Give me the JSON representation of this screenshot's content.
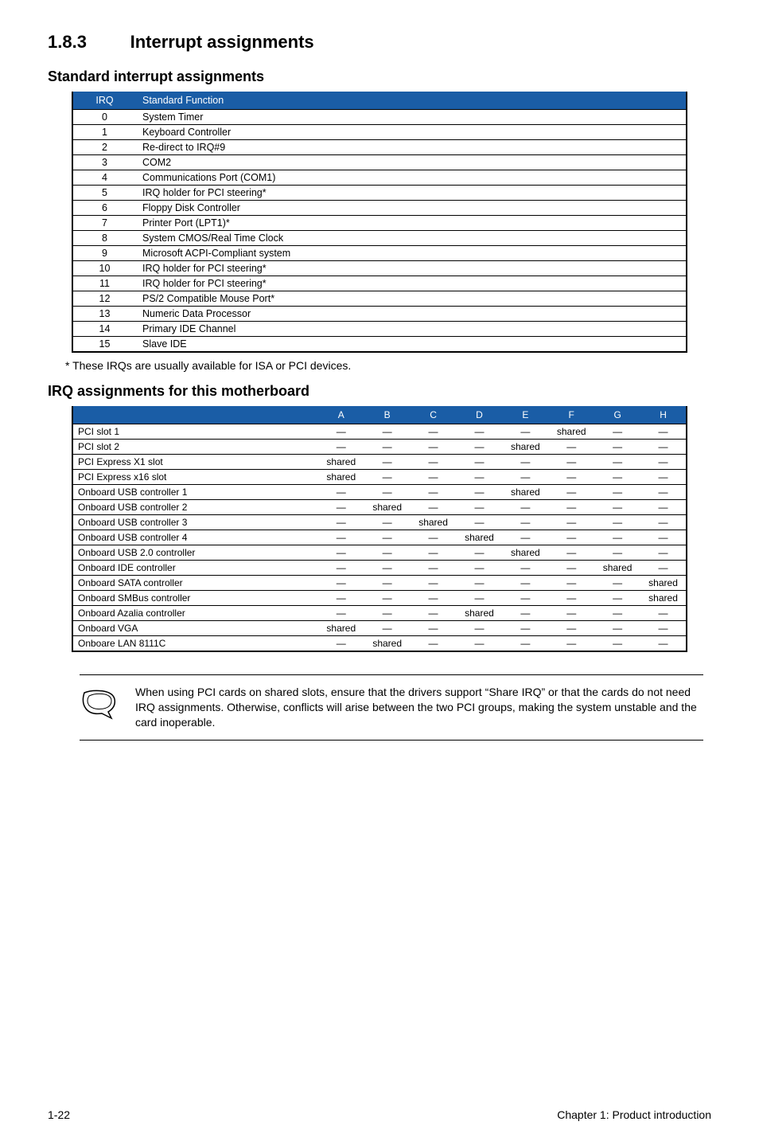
{
  "section": {
    "number": "1.8.3",
    "title": "Interrupt assignments"
  },
  "sub1": "Standard interrupt assignments",
  "table1": {
    "headers": [
      "IRQ",
      "Standard Function"
    ],
    "rows": [
      [
        "0",
        "System Timer"
      ],
      [
        "1",
        "Keyboard Controller"
      ],
      [
        "2",
        "Re-direct to IRQ#9"
      ],
      [
        "3",
        "COM2"
      ],
      [
        "4",
        "Communications Port (COM1)"
      ],
      [
        "5",
        "IRQ holder for PCI steering*"
      ],
      [
        "6",
        "Floppy Disk Controller"
      ],
      [
        "7",
        "Printer Port (LPT1)*"
      ],
      [
        "8",
        "System CMOS/Real Time Clock"
      ],
      [
        "9",
        "Microsoft ACPI-Compliant system"
      ],
      [
        "10",
        "IRQ holder for PCI steering*"
      ],
      [
        "11",
        "IRQ holder for PCI steering*"
      ],
      [
        "12",
        "PS/2 Compatible Mouse Port*"
      ],
      [
        "13",
        "Numeric Data Processor"
      ],
      [
        "14",
        "Primary IDE Channel"
      ],
      [
        "15",
        "Slave IDE"
      ]
    ]
  },
  "footnote": "* These IRQs are usually available for ISA or PCI devices.",
  "sub2": "IRQ assignments for this motherboard",
  "table2": {
    "headers": [
      "",
      "A",
      "B",
      "C",
      "D",
      "E",
      "F",
      "G",
      "H"
    ],
    "rows": [
      {
        "label": "PCI slot 1",
        "cells": [
          "—",
          "—",
          "—",
          "—",
          "—",
          "shared",
          "—",
          "—"
        ]
      },
      {
        "label": "PCI slot 2",
        "cells": [
          "—",
          "—",
          "—",
          "—",
          "shared",
          "—",
          "—",
          "—"
        ]
      },
      {
        "label": "PCI Express X1 slot",
        "cells": [
          "shared",
          "—",
          "—",
          "—",
          "—",
          "—",
          "—",
          "—"
        ]
      },
      {
        "label": "PCI Express x16 slot",
        "cells": [
          "shared",
          "—",
          "—",
          "—",
          "—",
          "—",
          "—",
          "—"
        ]
      },
      {
        "label": "Onboard USB controller 1",
        "cells": [
          "—",
          "—",
          "—",
          "—",
          "shared",
          "—",
          "—",
          "—"
        ]
      },
      {
        "label": "Onboard USB controller 2",
        "cells": [
          "—",
          "shared",
          "—",
          "—",
          "—",
          "—",
          "—",
          "—"
        ]
      },
      {
        "label": "Onboard USB controller 3",
        "cells": [
          "—",
          "—",
          "shared",
          "—",
          "—",
          "—",
          "—",
          "—"
        ]
      },
      {
        "label": "Onboard USB controller 4",
        "cells": [
          "—",
          "—",
          "—",
          "shared",
          "—",
          "—",
          "—",
          "—"
        ]
      },
      {
        "label": "Onboard USB 2.0 controller",
        "cells": [
          "—",
          "—",
          "—",
          "—",
          "shared",
          "—",
          "—",
          "—"
        ]
      },
      {
        "label": "Onboard IDE controller",
        "cells": [
          "—",
          "—",
          "—",
          "—",
          "—",
          "—",
          "shared",
          "—"
        ]
      },
      {
        "label": "Onboard SATA controller",
        "cells": [
          "—",
          "—",
          "—",
          "—",
          "—",
          "—",
          "—",
          "shared"
        ]
      },
      {
        "label": "Onboard SMBus controller",
        "cells": [
          "—",
          "—",
          "—",
          "—",
          "—",
          "—",
          "—",
          "shared"
        ]
      },
      {
        "label": "Onboard Azalia controller",
        "cells": [
          "—",
          "—",
          "—",
          "shared",
          "—",
          "—",
          "—",
          "—"
        ]
      },
      {
        "label": "Onboard VGA",
        "cells": [
          "shared",
          "—",
          "—",
          "—",
          "—",
          "—",
          "—",
          "—"
        ]
      },
      {
        "label": "Onboare LAN 8111C",
        "cells": [
          "—",
          "shared",
          "—",
          "—",
          "—",
          "—",
          "—",
          "—"
        ]
      }
    ]
  },
  "note": "When using PCI cards on shared slots, ensure that the drivers support “Share IRQ” or that the cards do not need IRQ assignments. Otherwise, conflicts will arise between the two PCI groups, making the system unstable and the card inoperable.",
  "footer": {
    "left": "1-22",
    "right": "Chapter 1: Product introduction"
  }
}
